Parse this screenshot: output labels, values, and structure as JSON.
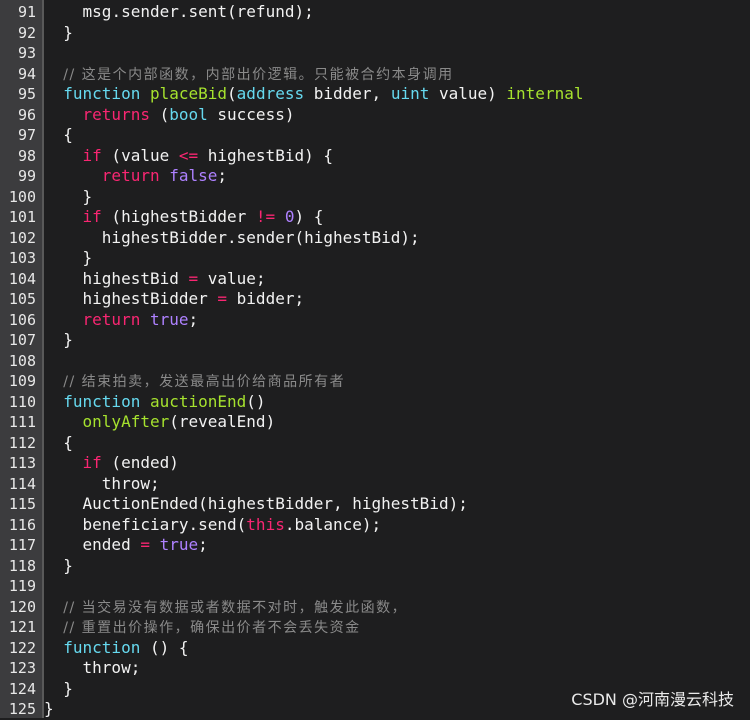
{
  "editor": {
    "lines": [
      {
        "n": "91",
        "tokens": [
          {
            "t": "    "
          },
          {
            "t": "msg",
            "c": "t-plain"
          },
          {
            "t": ".sender.sent(refund);"
          }
        ]
      },
      {
        "n": "92",
        "tokens": [
          {
            "t": "  }"
          }
        ]
      },
      {
        "n": "93",
        "tokens": []
      },
      {
        "n": "94",
        "tokens": [
          {
            "t": "  "
          },
          {
            "t": "// 这是个内部函数，内部出价逻辑。只能被合约本身调用",
            "c": "t-cm"
          }
        ]
      },
      {
        "n": "95",
        "tokens": [
          {
            "t": "  "
          },
          {
            "t": "function",
            "c": "t-kw"
          },
          {
            "t": " "
          },
          {
            "t": "placeBid",
            "c": "t-fn"
          },
          {
            "t": "("
          },
          {
            "t": "address",
            "c": "t-type"
          },
          {
            "t": " bidder, "
          },
          {
            "t": "uint",
            "c": "t-type"
          },
          {
            "t": " value) "
          },
          {
            "t": "internal",
            "c": "t-fn"
          }
        ]
      },
      {
        "n": "96",
        "tokens": [
          {
            "t": "    "
          },
          {
            "t": "returns",
            "c": "t-ctrl"
          },
          {
            "t": " ("
          },
          {
            "t": "bool",
            "c": "t-type"
          },
          {
            "t": " success)"
          }
        ]
      },
      {
        "n": "97",
        "tokens": [
          {
            "t": "  {"
          }
        ]
      },
      {
        "n": "98",
        "tokens": [
          {
            "t": "    "
          },
          {
            "t": "if",
            "c": "t-ctrl"
          },
          {
            "t": " (value "
          },
          {
            "t": "<=",
            "c": "t-op"
          },
          {
            "t": " highestBid) {"
          }
        ]
      },
      {
        "n": "99",
        "tokens": [
          {
            "t": "      "
          },
          {
            "t": "return",
            "c": "t-ctrl"
          },
          {
            "t": " "
          },
          {
            "t": "false",
            "c": "t-bool"
          },
          {
            "t": ";"
          }
        ]
      },
      {
        "n": "100",
        "tokens": [
          {
            "t": "    }"
          }
        ]
      },
      {
        "n": "101",
        "tokens": [
          {
            "t": "    "
          },
          {
            "t": "if",
            "c": "t-ctrl"
          },
          {
            "t": " (highestBidder "
          },
          {
            "t": "!=",
            "c": "t-op"
          },
          {
            "t": " "
          },
          {
            "t": "0",
            "c": "t-num"
          },
          {
            "t": ") {"
          }
        ]
      },
      {
        "n": "102",
        "tokens": [
          {
            "t": "      highestBidder.sender(highestBid);"
          }
        ]
      },
      {
        "n": "103",
        "tokens": [
          {
            "t": "    }"
          }
        ]
      },
      {
        "n": "104",
        "tokens": [
          {
            "t": "    highestBid "
          },
          {
            "t": "=",
            "c": "t-op"
          },
          {
            "t": " value;"
          }
        ]
      },
      {
        "n": "105",
        "tokens": [
          {
            "t": "    highestBidder "
          },
          {
            "t": "=",
            "c": "t-op"
          },
          {
            "t": " bidder;"
          }
        ]
      },
      {
        "n": "106",
        "tokens": [
          {
            "t": "    "
          },
          {
            "t": "return",
            "c": "t-ctrl"
          },
          {
            "t": " "
          },
          {
            "t": "true",
            "c": "t-bool"
          },
          {
            "t": ";"
          }
        ]
      },
      {
        "n": "107",
        "tokens": [
          {
            "t": "  }"
          }
        ]
      },
      {
        "n": "108",
        "tokens": []
      },
      {
        "n": "109",
        "tokens": [
          {
            "t": "  "
          },
          {
            "t": "// 结束拍卖，发送最高出价给商品所有者",
            "c": "t-cm"
          }
        ]
      },
      {
        "n": "110",
        "tokens": [
          {
            "t": "  "
          },
          {
            "t": "function",
            "c": "t-kw"
          },
          {
            "t": " "
          },
          {
            "t": "auctionEnd",
            "c": "t-fn"
          },
          {
            "t": "()"
          }
        ]
      },
      {
        "n": "111",
        "tokens": [
          {
            "t": "    "
          },
          {
            "t": "onlyAfter",
            "c": "t-fn"
          },
          {
            "t": "(revealEnd)"
          }
        ]
      },
      {
        "n": "112",
        "tokens": [
          {
            "t": "  {"
          }
        ]
      },
      {
        "n": "113",
        "tokens": [
          {
            "t": "    "
          },
          {
            "t": "if",
            "c": "t-ctrl"
          },
          {
            "t": " (ended)"
          }
        ]
      },
      {
        "n": "114",
        "tokens": [
          {
            "t": "      throw;"
          }
        ]
      },
      {
        "n": "115",
        "tokens": [
          {
            "t": "    AuctionEnded(highestBidder, highestBid);"
          }
        ]
      },
      {
        "n": "116",
        "tokens": [
          {
            "t": "    beneficiary.send("
          },
          {
            "t": "this",
            "c": "t-ctrl"
          },
          {
            "t": ".balance);"
          }
        ]
      },
      {
        "n": "117",
        "tokens": [
          {
            "t": "    ended "
          },
          {
            "t": "=",
            "c": "t-op"
          },
          {
            "t": " "
          },
          {
            "t": "true",
            "c": "t-bool"
          },
          {
            "t": ";"
          }
        ]
      },
      {
        "n": "118",
        "tokens": [
          {
            "t": "  }"
          }
        ]
      },
      {
        "n": "119",
        "tokens": []
      },
      {
        "n": "120",
        "tokens": [
          {
            "t": "  "
          },
          {
            "t": "// 当交易没有数据或者数据不对时，触发此函数，",
            "c": "t-cm"
          }
        ]
      },
      {
        "n": "121",
        "tokens": [
          {
            "t": "  "
          },
          {
            "t": "// 重置出价操作，确保出价者不会丢失资金",
            "c": "t-cm"
          }
        ]
      },
      {
        "n": "122",
        "tokens": [
          {
            "t": "  "
          },
          {
            "t": "function",
            "c": "t-kw"
          },
          {
            "t": " () {"
          }
        ]
      },
      {
        "n": "123",
        "tokens": [
          {
            "t": "    throw;"
          }
        ]
      },
      {
        "n": "124",
        "tokens": [
          {
            "t": "  }"
          }
        ]
      },
      {
        "n": "125",
        "tokens": [
          {
            "t": "}"
          }
        ]
      }
    ]
  },
  "watermark": "CSDN @河南漫云科技"
}
